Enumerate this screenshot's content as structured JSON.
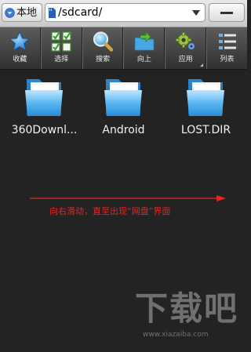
{
  "topbar": {
    "location_label": "本地",
    "path": "/sdcard/"
  },
  "toolbar": {
    "items": [
      {
        "label": "收藏",
        "icon": "star-icon"
      },
      {
        "label": "选择",
        "icon": "checkbox-grid-icon"
      },
      {
        "label": "搜索",
        "icon": "magnifier-icon"
      },
      {
        "label": "向上",
        "icon": "folder-up-icon"
      },
      {
        "label": "应用",
        "icon": "gears-icon"
      },
      {
        "label": "列表",
        "icon": "list-view-icon"
      }
    ]
  },
  "files": [
    {
      "name": "360Downl...",
      "icon": "folder-icon"
    },
    {
      "name": "Android",
      "icon": "folder-icon"
    },
    {
      "name": "LOST.DIR",
      "icon": "folder-icon"
    }
  ],
  "annotation": {
    "text": "向右滑动，直至出现“网盘”界面",
    "color": "#e3281f"
  },
  "watermark": {
    "main": "下载吧",
    "sub": "www.xiazaiba.com"
  },
  "colors": {
    "background": "#232323",
    "folder_blue": "#3aa2e8",
    "toolbar": "#454545"
  }
}
